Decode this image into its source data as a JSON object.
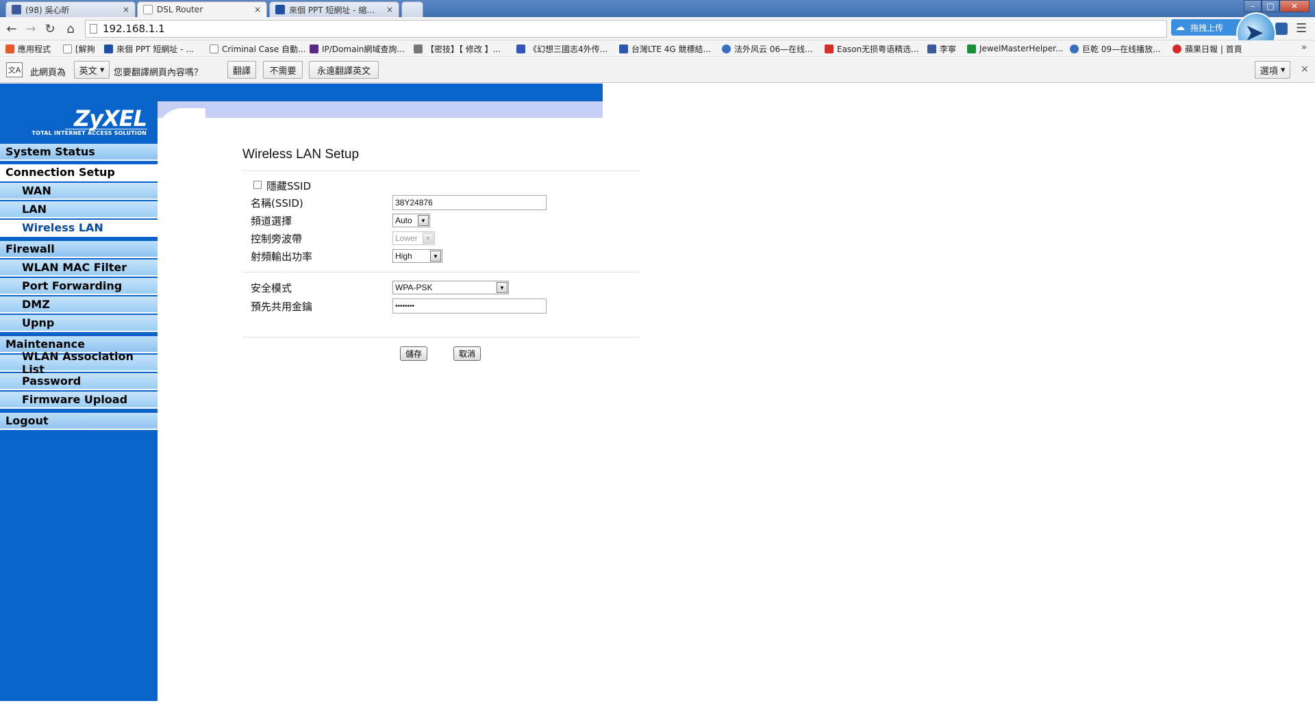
{
  "browser": {
    "tabs": [
      {
        "title": "(98) 吳心昕",
        "favicon_color": "#3b5998"
      },
      {
        "title": "DSL Router",
        "favicon_color": "#ffffff"
      },
      {
        "title": "來個 PPT 短網址 - 縮圖網",
        "favicon_color": "#1f4fa0"
      },
      {
        "title": "",
        "favicon_color": "#cfd9e8"
      }
    ],
    "tab_close": "×",
    "window_controls": {
      "minimize": "–",
      "maximize": "□",
      "close": "✕"
    },
    "url": "192.168.1.1",
    "extension_upload_label": "拖拽上传",
    "menu_icon": "☰"
  },
  "bookmarks": {
    "items": [
      {
        "label": "應用程式",
        "icon": "apps-icon",
        "color": "#e05a2b"
      },
      {
        "label": "[解夠",
        "icon": "page-icon",
        "color": "#ffffff"
      },
      {
        "label": "來個 PPT 短網址 - ...",
        "icon": "ppt-icon",
        "color": "#1f4fa0"
      },
      {
        "label": "Criminal Case 自動...",
        "icon": "page-icon",
        "color": "#ffffff"
      },
      {
        "label": "IP/Domain網域查詢...",
        "icon": "ip-icon",
        "color": "#5a2a86"
      },
      {
        "label": "【密技】【 修改 】...",
        "icon": "bird-icon",
        "color": "#777777"
      },
      {
        "label": "《幻想三國志4外传...",
        "icon": "game-icon",
        "color": "#3556b8"
      },
      {
        "label": "台灣LTE 4G 競標結...",
        "icon": "chat-icon",
        "color": "#2f56a8"
      },
      {
        "label": "法外风云 06—在线...",
        "icon": "play-icon",
        "color": "#3a6fc0"
      },
      {
        "label": "Eason无损粤语精选...",
        "icon": "huawei-icon",
        "color": "#d4302b"
      },
      {
        "label": "李寧",
        "icon": "facebook-icon",
        "color": "#3b5998"
      },
      {
        "label": "JewelMasterHelper...",
        "icon": "sheet-icon",
        "color": "#1d8f3a"
      },
      {
        "label": "巨乾 09—在线播放...",
        "icon": "play-icon",
        "color": "#3a6fc0"
      },
      {
        "label": "蘋果日報 | 首頁",
        "icon": "apple-icon",
        "color": "#d22b2b"
      }
    ],
    "more": "»"
  },
  "translate_bar": {
    "prefix": "此網頁為",
    "language": "英文",
    "question": "您要翻譯網頁內容嗎？",
    "translate_button": "翻譯",
    "no_button": "不需要",
    "always_button": "永遠翻譯英文",
    "options_button": "選項",
    "close": "×"
  },
  "router": {
    "logo": "ZyXEL",
    "logo_tagline": "TOTAL INTERNET ACCESS SOLUTION",
    "nav": [
      {
        "label": "System Status",
        "type": "main",
        "active": false
      },
      {
        "label": "Connection Setup",
        "type": "main",
        "active": true
      },
      {
        "label": "WAN",
        "type": "sub",
        "active": false
      },
      {
        "label": "LAN",
        "type": "sub",
        "active": false
      },
      {
        "label": "Wireless LAN",
        "type": "sub",
        "active": true
      },
      {
        "label": "Firewall",
        "type": "main",
        "active": false
      },
      {
        "label": "WLAN MAC Filter",
        "type": "sub",
        "active": false
      },
      {
        "label": "Port Forwarding",
        "type": "sub",
        "active": false
      },
      {
        "label": "DMZ",
        "type": "sub",
        "active": false
      },
      {
        "label": "Upnp",
        "type": "sub",
        "active": false
      },
      {
        "label": "Maintenance",
        "type": "main",
        "active": false
      },
      {
        "label": "WLAN Association List",
        "type": "sub",
        "active": false
      },
      {
        "label": "Password",
        "type": "sub",
        "active": false
      },
      {
        "label": "Firmware Upload",
        "type": "sub",
        "active": false
      },
      {
        "label": "Logout",
        "type": "main",
        "active": false
      }
    ],
    "page_title": "Wireless LAN Setup",
    "form": {
      "hide_ssid_label": "隱藏SSID",
      "hide_ssid_checked": false,
      "ssid_label": "名稱(SSID)",
      "ssid_value": "38Y24876",
      "channel_label": "頻道選擇",
      "channel_value": "Auto",
      "sideband_label": "控制旁波帶",
      "sideband_value": "Lower",
      "tx_power_label": "射頻輸出功率",
      "tx_power_value": "High",
      "security_label": "安全模式",
      "security_value": "WPA-PSK",
      "psk_label": "預先共用金鑰",
      "psk_value": "••••••••"
    },
    "save_button": "儲存",
    "cancel_button": "取消"
  },
  "colors": {
    "sidebar_blue": "#0a63c9",
    "nav_light_blue": "#9bccf2",
    "header_lavender": "#c7cff6"
  }
}
